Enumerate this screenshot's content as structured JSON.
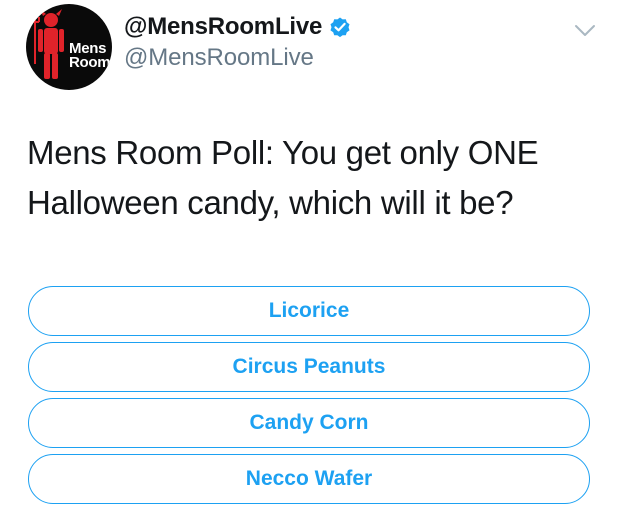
{
  "account": {
    "display_name": "@MensRoomLive",
    "handle": "@MensRoomLive",
    "verified": true,
    "avatar": {
      "line1": "Mens",
      "line2": "Room",
      "icon": "devil-man-icon",
      "colors": {
        "background": "#0a0a0a",
        "figure": "#e0232a",
        "text": "#ffffff"
      }
    }
  },
  "menu": {
    "icon": "chevron-down-icon"
  },
  "tweet": {
    "lines": [
      "Mens Room Poll: You get only ONE",
      "Halloween candy, which will it be?"
    ]
  },
  "poll": {
    "options": [
      {
        "label": "Licorice"
      },
      {
        "label": "Circus Peanuts"
      },
      {
        "label": "Candy Corn"
      },
      {
        "label": "Necco Wafer"
      }
    ]
  },
  "colors": {
    "accent": "#1da1f2",
    "text": "#14171a",
    "muted": "#657786"
  }
}
